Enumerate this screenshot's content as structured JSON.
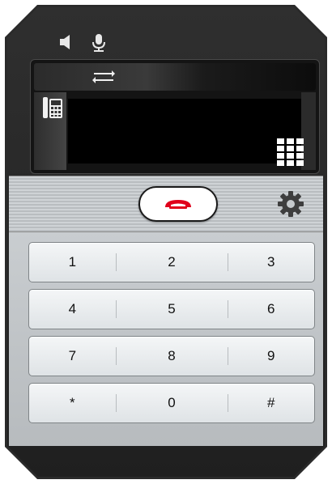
{
  "status_bar": {
    "speaker_icon": "speaker-icon",
    "microphone_icon": "microphone-icon"
  },
  "screen": {
    "transfer_icon": "transfer-arrows-icon",
    "phone_icon": "desk-phone-icon",
    "display_text": "",
    "keypad_toggle_icon": "keypad-grid-icon"
  },
  "controls": {
    "hangup_icon": "hangup-icon",
    "settings_icon": "gear-icon"
  },
  "keypad": {
    "rows": [
      [
        "1",
        "2",
        "3"
      ],
      [
        "4",
        "5",
        "6"
      ],
      [
        "7",
        "8",
        "9"
      ],
      [
        "*",
        "0",
        "#"
      ]
    ]
  },
  "colors": {
    "hangup_red": "#e0001b",
    "body_dark": "#2a2a2a",
    "panel_grey": "#c6cacd"
  }
}
